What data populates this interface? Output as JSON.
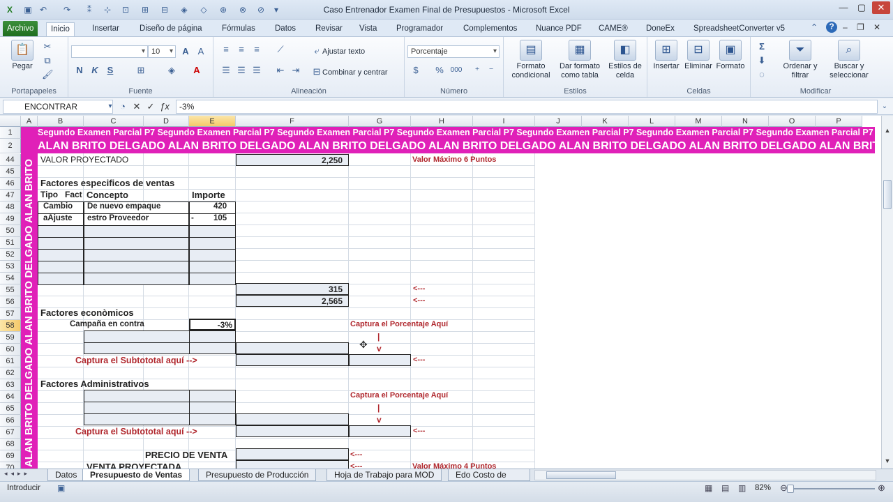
{
  "window": {
    "title": "Caso Entrenador  Examen Final de Presupuestos  -  Microsoft Excel",
    "minimize": "—",
    "maximize": "▢",
    "close": "✕"
  },
  "ribbon_tabs": [
    "Archivo",
    "Inicio",
    "Insertar",
    "Diseño de página",
    "Fórmulas",
    "Datos",
    "Revisar",
    "Vista",
    "Programador",
    "Complementos",
    "Nuance PDF",
    "CAME®",
    "DoneEx",
    "SpreadsheetConverter v5"
  ],
  "ribbon": {
    "portapapeles": {
      "label": "Portapapeles",
      "paste": "Pegar"
    },
    "fuente": {
      "label": "Fuente",
      "font_name": "",
      "font_size": "10",
      "bold": "N",
      "italic": "K",
      "underline": "S"
    },
    "alineacion": {
      "label": "Alineación",
      "wrap": "Ajustar texto",
      "merge": "Combinar y centrar"
    },
    "numero": {
      "label": "Número",
      "format": "Porcentaje",
      "currency": "$",
      "percent": "%",
      "thousands": "000"
    },
    "estilos": {
      "label": "Estilos",
      "conditional": "Formato condicional",
      "as_table": "Dar formato como tabla",
      "cell_styles": "Estilos de celda"
    },
    "celdas": {
      "label": "Celdas",
      "insert": "Insertar",
      "delete": "Eliminar",
      "format": "Formato"
    },
    "modificar": {
      "label": "Modificar",
      "sort": "Ordenar y filtrar",
      "find": "Buscar y seleccionar"
    }
  },
  "formula_bar": {
    "name_box": "ENCONTRAR",
    "formula": "-3%"
  },
  "columns": [
    "A",
    "B",
    "C",
    "D",
    "E",
    "F",
    "G",
    "H",
    "I",
    "J",
    "K",
    "L",
    "M",
    "N",
    "O",
    "P"
  ],
  "rows": [
    "1",
    "2",
    "44",
    "45",
    "46",
    "47",
    "48",
    "49",
    "50",
    "51",
    "52",
    "53",
    "54",
    "55",
    "56",
    "57",
    "58",
    "59",
    "60",
    "61",
    "62",
    "63",
    "64",
    "65",
    "66",
    "67",
    "68",
    "69",
    "70"
  ],
  "banner": {
    "row1": "Segundo Examen Parcial P7",
    "row2": "ALAN BRITO DELGADO",
    "vertical": "ALAN BRITO DELGADO ALAN BRITO DELGADO ALAN BRITO"
  },
  "cells": {
    "valor_proyectado_label": "VALOR PROYECTADO",
    "valor_proyectado": "2,250",
    "valor_max_6": "Valor Máximo 6 Puntos",
    "factores_especificos": "Factores especificos de ventas",
    "hdr_tipo": "Tipo",
    "hdr_fact": "Fact",
    "hdr_concepto": "Concepto",
    "hdr_importe": "Importe",
    "r48_tipo": "Cambio",
    "r48_concepto": "De nuevo empaque",
    "r48_importe": "420",
    "r49_tipo": "aAjuste",
    "r49_concepto": "estro Proveedor",
    "r49_sign": "-",
    "r49_importe": "105",
    "r55_value": "315",
    "r55_arrow": "<---",
    "r56_value": "2,565",
    "r56_arrow": "<---",
    "factores_economicos": "Factores econòmicos",
    "campana": "Campaña en contra",
    "campana_pct": "-3%",
    "captura_pct_1": "Captura el Porcentaje Aquí",
    "pipe_1": "|",
    "v_1": "v",
    "subtotal_1": "Captura el Subtototal aquí -->",
    "arrow_61": "<---",
    "factores_admin": "Factores Administrativos",
    "captura_pct_2": "Captura el Porcentaje Aquí",
    "pipe_2": "|",
    "v_2": "v",
    "subtotal_2": "Captura el Subtototal aquí -->",
    "arrow_67": "<---",
    "precio_venta": "PRECIO DE VENTA",
    "arrow_69": "<---",
    "venta_proyectada": "VENTA PROYECTADA",
    "arrow_70": "<---",
    "valor_max_4": "Valor Máximo 4 Puntos"
  },
  "sheet_tabs": [
    "Datos",
    "Presupuesto de Ventas",
    "Presupuesto de Producción",
    "Hoja de Trabajo para MOD",
    "Edo Costo de Ven"
  ],
  "status": {
    "mode": "Introducir",
    "zoom": "82%"
  },
  "colors": {
    "banner": "#e020b8",
    "accent_red": "#b0272d",
    "file_tab": "#2a7d2a"
  }
}
